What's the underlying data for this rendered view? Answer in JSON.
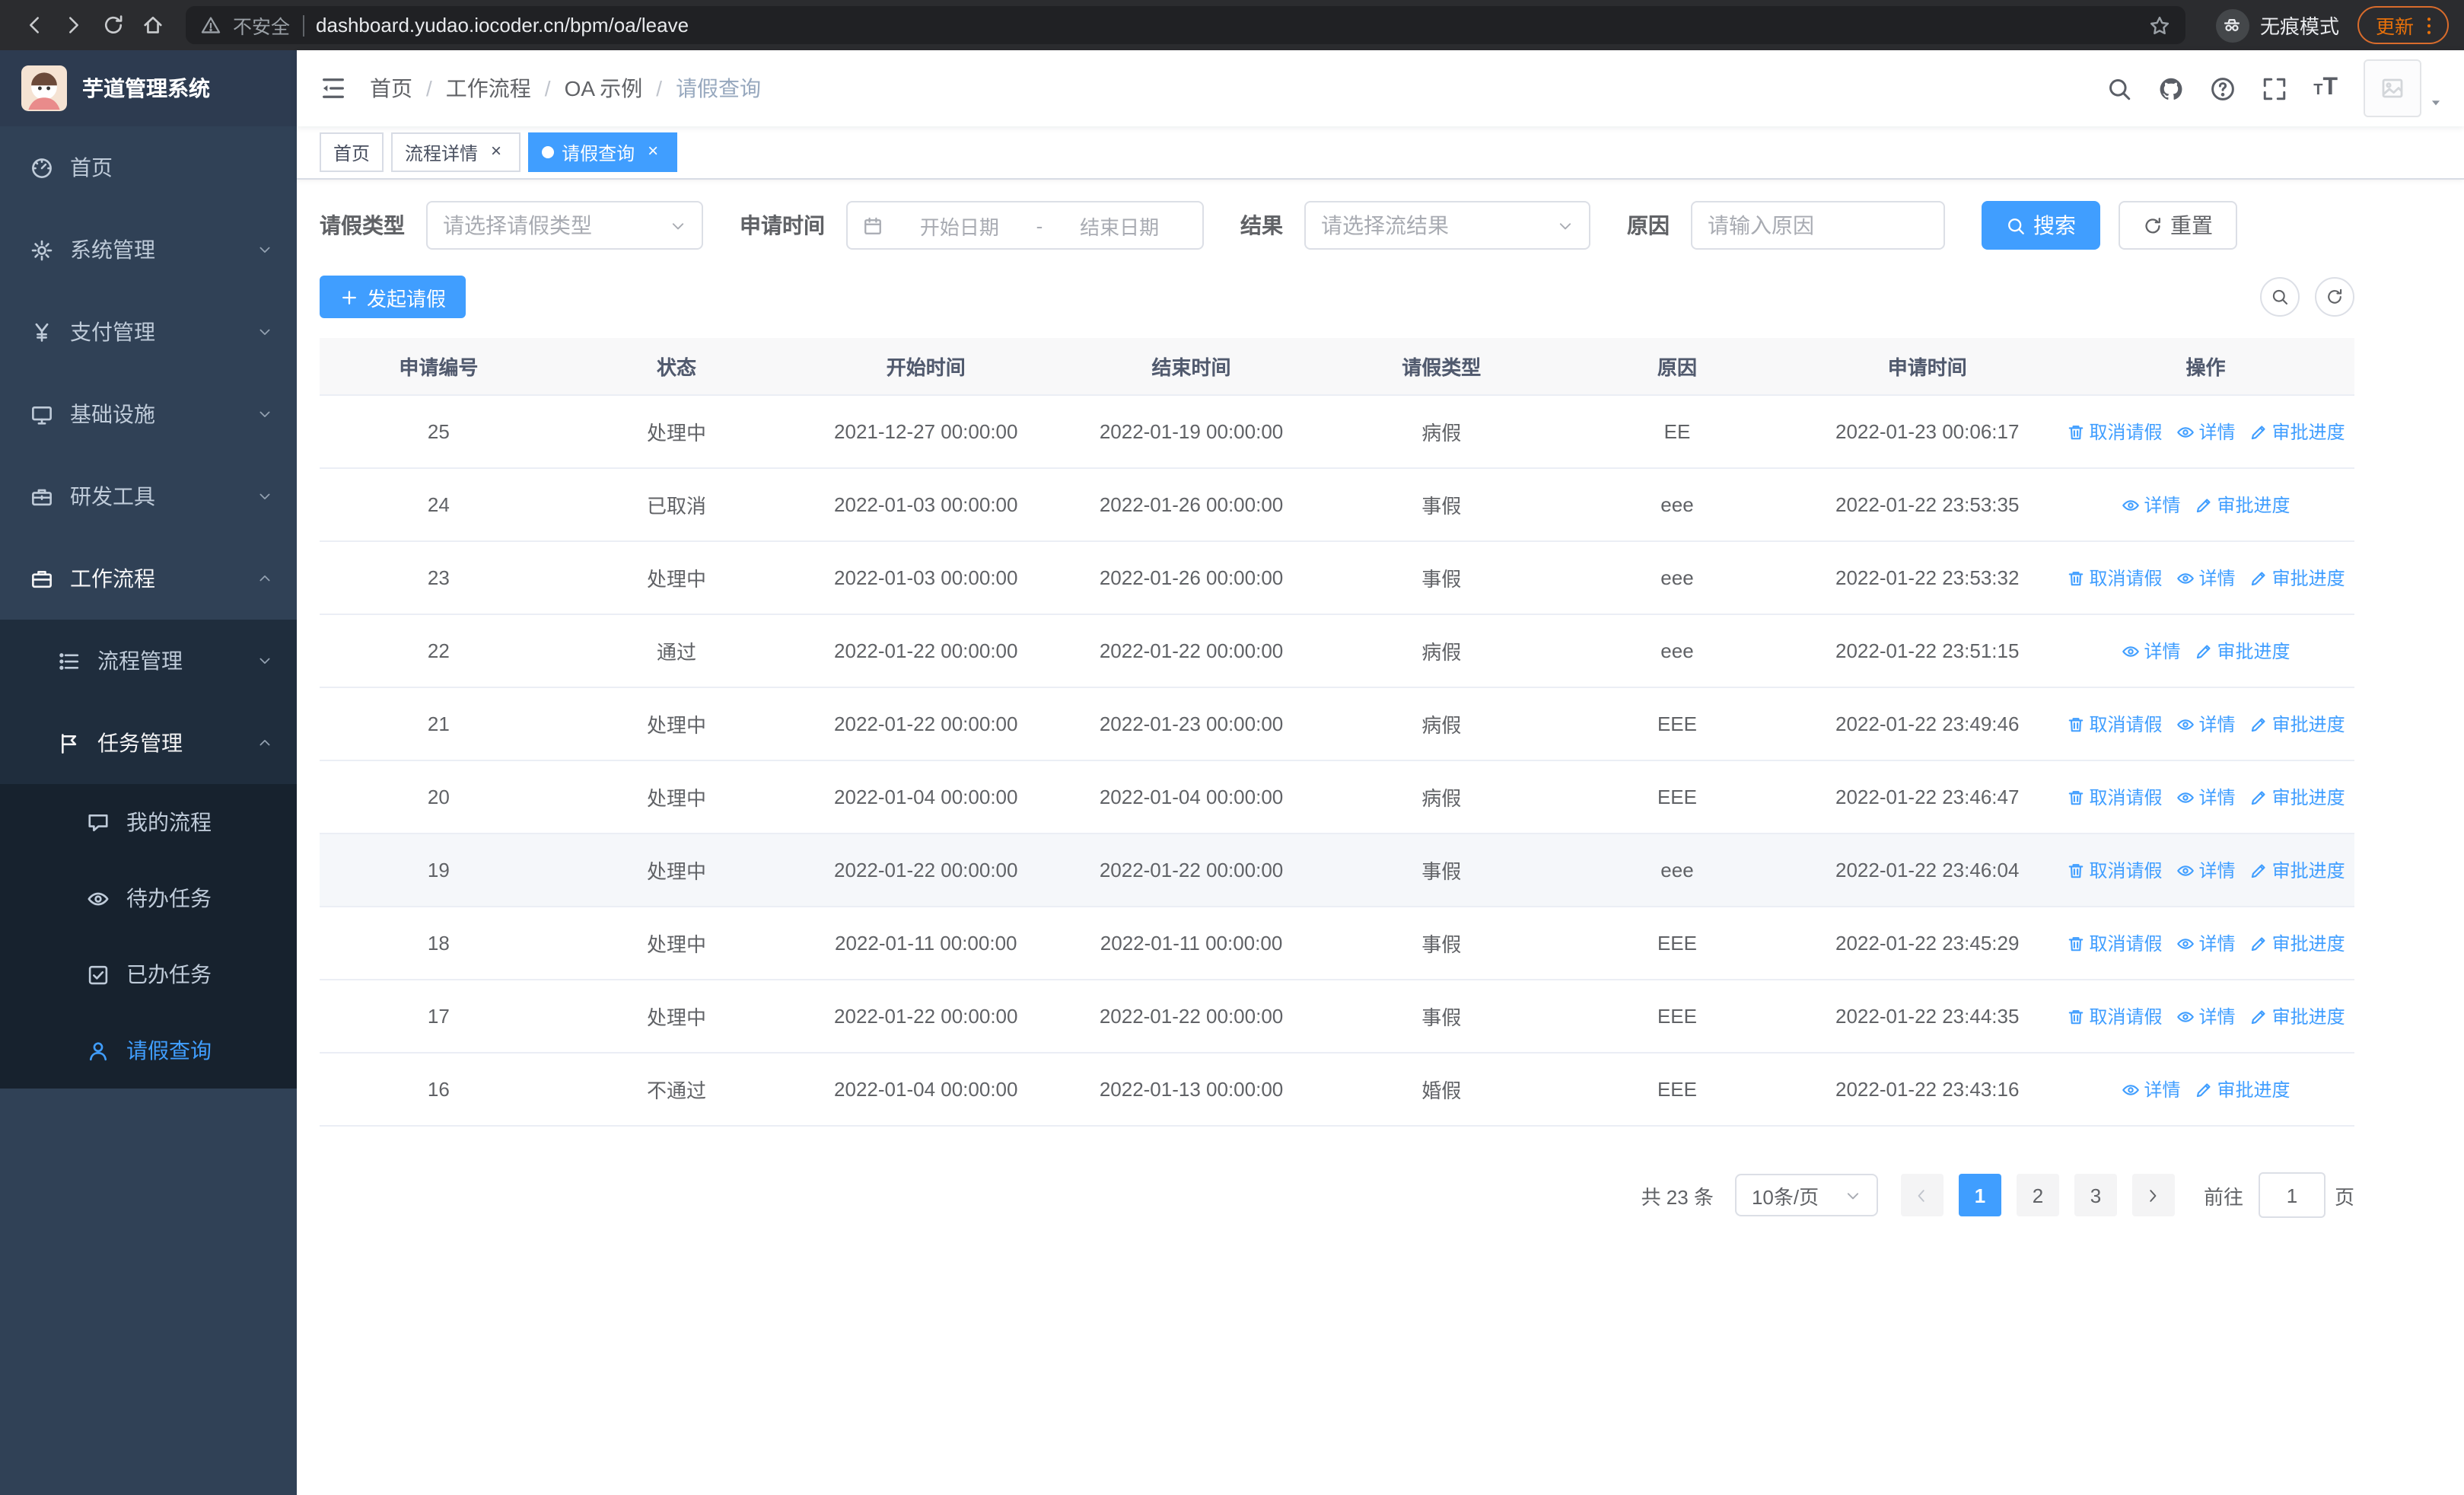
{
  "browser": {
    "security_label": "不安全",
    "url": "dashboard.yudao.iocoder.cn/bpm/oa/leave",
    "incognito_label": "无痕模式",
    "update_label": "更新"
  },
  "sidebar": {
    "logo_title": "芋道管理系统",
    "items": [
      {
        "label": "首页",
        "icon": "dashboard-icon",
        "level": 1
      },
      {
        "label": "系统管理",
        "icon": "gear-icon",
        "level": 1,
        "chevron": "down"
      },
      {
        "label": "支付管理",
        "icon": "yen-icon",
        "level": 1,
        "chevron": "down"
      },
      {
        "label": "基础设施",
        "icon": "monitor-icon",
        "level": 1,
        "chevron": "down"
      },
      {
        "label": "研发工具",
        "icon": "toolbox-icon",
        "level": 1,
        "chevron": "down"
      },
      {
        "label": "工作流程",
        "icon": "briefcase-icon",
        "level": 1,
        "chevron": "up",
        "open": true
      },
      {
        "label": "流程管理",
        "icon": "list-icon",
        "level": 2,
        "chevron": "down"
      },
      {
        "label": "任务管理",
        "icon": "flag-icon",
        "level": 2,
        "chevron": "up",
        "open": true
      },
      {
        "label": "我的流程",
        "icon": "chat-icon",
        "level": 3
      },
      {
        "label": "待办任务",
        "icon": "eye-icon",
        "level": 3
      },
      {
        "label": "已办任务",
        "icon": "check-square-icon",
        "level": 3
      },
      {
        "label": "请假查询",
        "icon": "user-icon",
        "level": 3,
        "active": true
      }
    ]
  },
  "navbar": {
    "breadcrumb": [
      "首页",
      "工作流程",
      "OA 示例",
      "请假查询"
    ]
  },
  "tabs": [
    {
      "label": "首页"
    },
    {
      "label": "流程详情",
      "closable": true
    },
    {
      "label": "请假查询",
      "closable": true,
      "active": true
    }
  ],
  "filters": {
    "leave_type_label": "请假类型",
    "leave_type_placeholder": "请选择请假类型",
    "apply_time_label": "申请时间",
    "start_date_placeholder": "开始日期",
    "range_separator": "-",
    "end_date_placeholder": "结束日期",
    "result_label": "结果",
    "result_placeholder": "请选择流结果",
    "reason_label": "原因",
    "reason_placeholder": "请输入原因",
    "search_label": "搜索",
    "reset_label": "重置"
  },
  "toolbar": {
    "create_label": "发起请假"
  },
  "table": {
    "columns": [
      "申请编号",
      "状态",
      "开始时间",
      "结束时间",
      "请假类型",
      "原因",
      "申请时间",
      "操作"
    ],
    "action_labels": {
      "cancel": "取消请假",
      "detail": "详情",
      "progress": "审批进度"
    },
    "rows": [
      {
        "id": "25",
        "status": "处理中",
        "start": "2021-12-27 00:00:00",
        "end": "2022-01-19 00:00:00",
        "type": "病假",
        "reason": "EE",
        "apply_time": "2022-01-23 00:06:17",
        "cancellable": true
      },
      {
        "id": "24",
        "status": "已取消",
        "start": "2022-01-03 00:00:00",
        "end": "2022-01-26 00:00:00",
        "type": "事假",
        "reason": "eee",
        "apply_time": "2022-01-22 23:53:35",
        "cancellable": false
      },
      {
        "id": "23",
        "status": "处理中",
        "start": "2022-01-03 00:00:00",
        "end": "2022-01-26 00:00:00",
        "type": "事假",
        "reason": "eee",
        "apply_time": "2022-01-22 23:53:32",
        "cancellable": true
      },
      {
        "id": "22",
        "status": "通过",
        "start": "2022-01-22 00:00:00",
        "end": "2022-01-22 00:00:00",
        "type": "病假",
        "reason": "eee",
        "apply_time": "2022-01-22 23:51:15",
        "cancellable": false
      },
      {
        "id": "21",
        "status": "处理中",
        "start": "2022-01-22 00:00:00",
        "end": "2022-01-23 00:00:00",
        "type": "病假",
        "reason": "EEE",
        "apply_time": "2022-01-22 23:49:46",
        "cancellable": true
      },
      {
        "id": "20",
        "status": "处理中",
        "start": "2022-01-04 00:00:00",
        "end": "2022-01-04 00:00:00",
        "type": "病假",
        "reason": "EEE",
        "apply_time": "2022-01-22 23:46:47",
        "cancellable": true
      },
      {
        "id": "19",
        "status": "处理中",
        "start": "2022-01-22 00:00:00",
        "end": "2022-01-22 00:00:00",
        "type": "事假",
        "reason": "eee",
        "apply_time": "2022-01-22 23:46:04",
        "cancellable": true,
        "highlighted": true
      },
      {
        "id": "18",
        "status": "处理中",
        "start": "2022-01-11 00:00:00",
        "end": "2022-01-11 00:00:00",
        "type": "事假",
        "reason": "EEE",
        "apply_time": "2022-01-22 23:45:29",
        "cancellable": true
      },
      {
        "id": "17",
        "status": "处理中",
        "start": "2022-01-22 00:00:00",
        "end": "2022-01-22 00:00:00",
        "type": "事假",
        "reason": "EEE",
        "apply_time": "2022-01-22 23:44:35",
        "cancellable": true
      },
      {
        "id": "16",
        "status": "不通过",
        "start": "2022-01-04 00:00:00",
        "end": "2022-01-13 00:00:00",
        "type": "婚假",
        "reason": "EEE",
        "apply_time": "2022-01-22 23:43:16",
        "cancellable": false
      }
    ]
  },
  "pagination": {
    "total_label": "共 23 条",
    "page_size": "10条/页",
    "pages": [
      "1",
      "2",
      "3"
    ],
    "current_page": "1",
    "goto_label": "前往",
    "goto_value": "1",
    "page_suffix_label": "页"
  },
  "colors": {
    "primary": "#409eff",
    "sidebar_bg": "#304156",
    "sidebar_submenu_bg": "#1f2d3d",
    "active_tab_bg": "#409eff",
    "update_pill": "#e8710a",
    "table_header_bg": "#f8f8f9"
  }
}
